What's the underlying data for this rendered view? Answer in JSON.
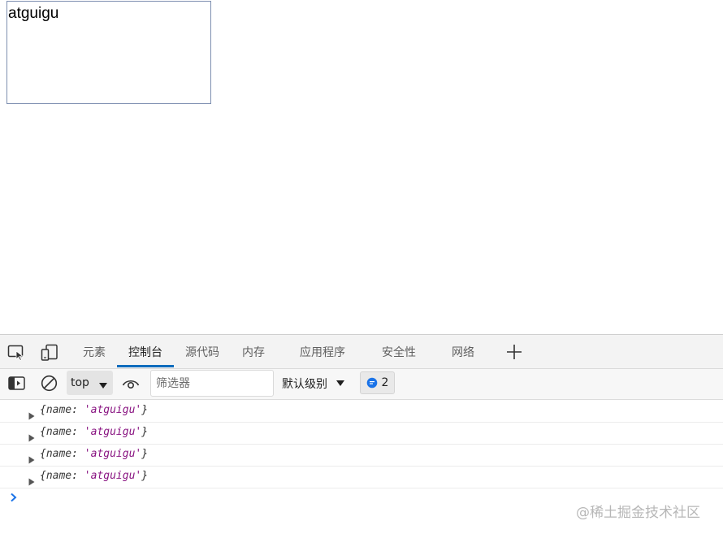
{
  "viewport": {
    "box_text": "atguigu"
  },
  "devtools": {
    "tabs": [
      {
        "label": "元素"
      },
      {
        "label": "控制台",
        "active": true
      },
      {
        "label": "源代码"
      },
      {
        "label": "内存"
      },
      {
        "label": "应用程序"
      },
      {
        "label": "安全性"
      },
      {
        "label": "网络"
      }
    ],
    "icons": {
      "inspect": "inspect-element-icon",
      "device": "device-emulation-icon",
      "add_tab": "plus-icon",
      "sidebar": "sidebar-toggle-icon",
      "clear": "clear-console-icon",
      "live_expression": "eye-icon",
      "issues": "message-icon"
    },
    "toolbar": {
      "context": "top",
      "filter_placeholder": "筛选器",
      "level": "默认级别",
      "message_count": "2"
    },
    "console": {
      "logs": [
        {
          "prefix": "{",
          "key": "name",
          "sep": ": ",
          "value": "'atguigu'",
          "suffix": "}"
        },
        {
          "prefix": "{",
          "key": "name",
          "sep": ": ",
          "value": "'atguigu'",
          "suffix": "}"
        },
        {
          "prefix": "{",
          "key": "name",
          "sep": ": ",
          "value": "'atguigu'",
          "suffix": "}"
        },
        {
          "prefix": "{",
          "key": "name",
          "sep": ": ",
          "value": "'atguigu'",
          "suffix": "}"
        }
      ]
    },
    "colors": {
      "accent": "#0f6cbd",
      "string_value": "#881280",
      "badge_icon": "#1a73e8"
    }
  },
  "watermark": "@稀土掘金技术社区"
}
